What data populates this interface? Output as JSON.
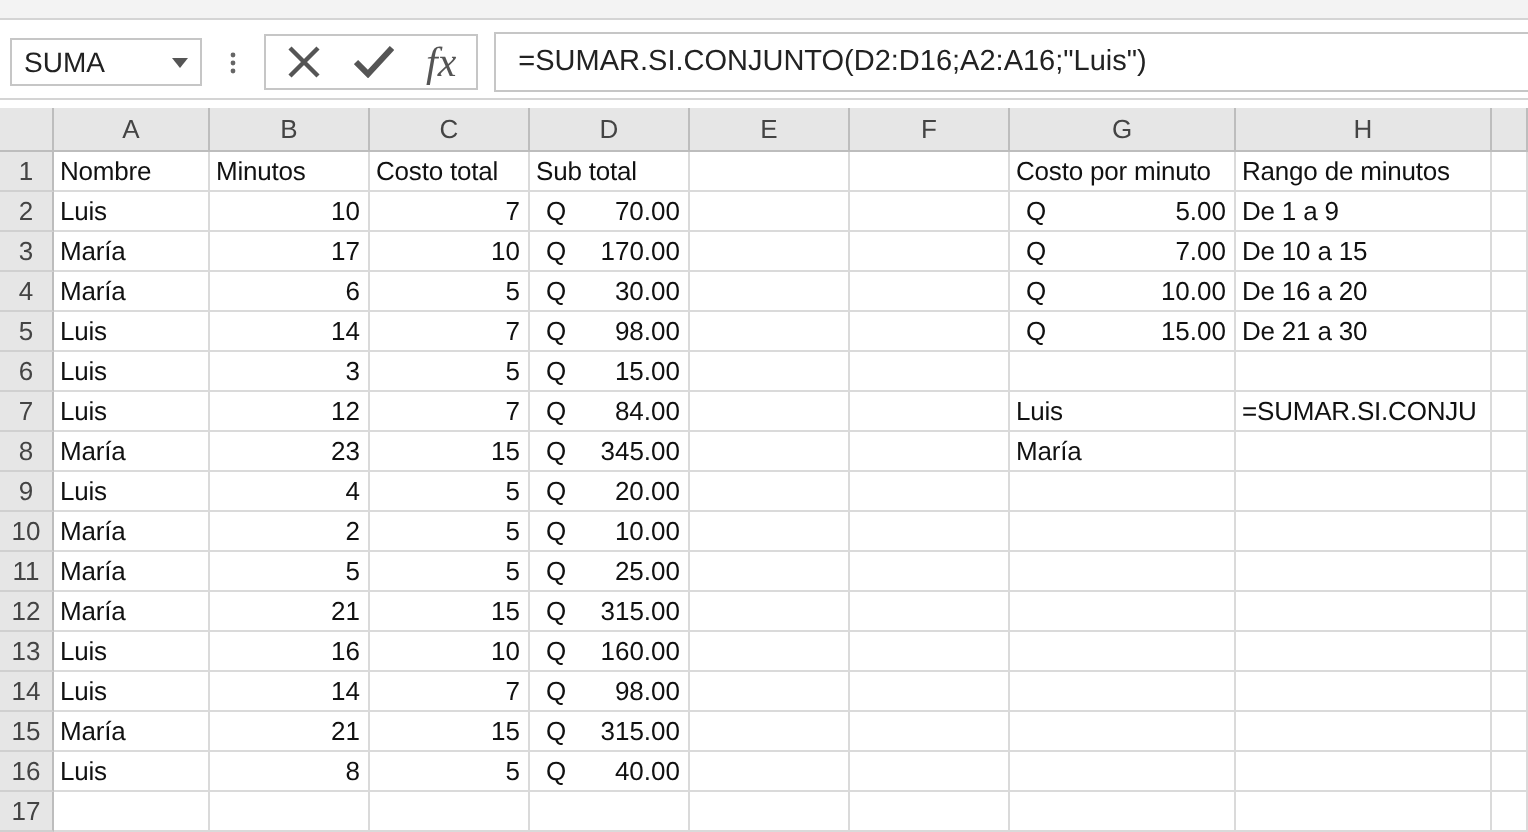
{
  "name_box": {
    "value": "SUMA"
  },
  "formula_bar": {
    "function_button": "fx",
    "formula": "=SUMAR.SI.CONJUNTO(D2:D16;A2:A16;\"Luis\")"
  },
  "columns": [
    "A",
    "B",
    "C",
    "D",
    "E",
    "F",
    "G",
    "H"
  ],
  "rows": [
    {
      "number": "1",
      "cells": [
        {
          "kind": "text",
          "text": "Nombre"
        },
        {
          "kind": "text",
          "text": "Minutos"
        },
        {
          "kind": "text",
          "text": "Costo total"
        },
        {
          "kind": "text",
          "text": "Sub total"
        },
        null,
        null,
        {
          "kind": "text",
          "text": "Costo por minuto"
        },
        {
          "kind": "text",
          "text": "Rango de minutos"
        }
      ]
    },
    {
      "number": "2",
      "cells": [
        {
          "kind": "text",
          "text": "Luis"
        },
        {
          "kind": "number",
          "text": "10"
        },
        {
          "kind": "number",
          "text": "7"
        },
        {
          "kind": "accounting",
          "symbol": "Q",
          "text": "70.00"
        },
        null,
        null,
        {
          "kind": "accounting",
          "symbol": "Q",
          "text": "5.00"
        },
        {
          "kind": "text",
          "text": "De 1 a 9"
        }
      ]
    },
    {
      "number": "3",
      "cells": [
        {
          "kind": "text",
          "text": "María"
        },
        {
          "kind": "number",
          "text": "17"
        },
        {
          "kind": "number",
          "text": "10"
        },
        {
          "kind": "accounting",
          "symbol": "Q",
          "text": "170.00"
        },
        null,
        null,
        {
          "kind": "accounting",
          "symbol": "Q",
          "text": "7.00"
        },
        {
          "kind": "text",
          "text": "De 10 a 15"
        }
      ]
    },
    {
      "number": "4",
      "cells": [
        {
          "kind": "text",
          "text": "María"
        },
        {
          "kind": "number",
          "text": "6"
        },
        {
          "kind": "number",
          "text": "5"
        },
        {
          "kind": "accounting",
          "symbol": "Q",
          "text": "30.00"
        },
        null,
        null,
        {
          "kind": "accounting",
          "symbol": "Q",
          "text": "10.00"
        },
        {
          "kind": "text",
          "text": "De 16 a 20"
        }
      ]
    },
    {
      "number": "5",
      "cells": [
        {
          "kind": "text",
          "text": "Luis"
        },
        {
          "kind": "number",
          "text": "14"
        },
        {
          "kind": "number",
          "text": "7"
        },
        {
          "kind": "accounting",
          "symbol": "Q",
          "text": "98.00"
        },
        null,
        null,
        {
          "kind": "accounting",
          "symbol": "Q",
          "text": "15.00"
        },
        {
          "kind": "text",
          "text": "De 21 a 30"
        }
      ]
    },
    {
      "number": "6",
      "cells": [
        {
          "kind": "text",
          "text": "Luis"
        },
        {
          "kind": "number",
          "text": "3"
        },
        {
          "kind": "number",
          "text": "5"
        },
        {
          "kind": "accounting",
          "symbol": "Q",
          "text": "15.00"
        },
        null,
        null,
        null,
        null
      ]
    },
    {
      "number": "7",
      "cells": [
        {
          "kind": "text",
          "text": "Luis"
        },
        {
          "kind": "number",
          "text": "12"
        },
        {
          "kind": "number",
          "text": "7"
        },
        {
          "kind": "accounting",
          "symbol": "Q",
          "text": "84.00"
        },
        null,
        null,
        {
          "kind": "text",
          "text": "Luis"
        },
        {
          "kind": "text",
          "text": "=SUMAR.SI.CONJU"
        }
      ]
    },
    {
      "number": "8",
      "cells": [
        {
          "kind": "text",
          "text": "María"
        },
        {
          "kind": "number",
          "text": "23"
        },
        {
          "kind": "number",
          "text": "15"
        },
        {
          "kind": "accounting",
          "symbol": "Q",
          "text": "345.00"
        },
        null,
        null,
        {
          "kind": "text",
          "text": "María"
        },
        null
      ]
    },
    {
      "number": "9",
      "cells": [
        {
          "kind": "text",
          "text": "Luis"
        },
        {
          "kind": "number",
          "text": "4"
        },
        {
          "kind": "number",
          "text": "5"
        },
        {
          "kind": "accounting",
          "symbol": "Q",
          "text": "20.00"
        },
        null,
        null,
        null,
        null
      ]
    },
    {
      "number": "10",
      "cells": [
        {
          "kind": "text",
          "text": "María"
        },
        {
          "kind": "number",
          "text": "2"
        },
        {
          "kind": "number",
          "text": "5"
        },
        {
          "kind": "accounting",
          "symbol": "Q",
          "text": "10.00"
        },
        null,
        null,
        null,
        null
      ]
    },
    {
      "number": "11",
      "cells": [
        {
          "kind": "text",
          "text": "María"
        },
        {
          "kind": "number",
          "text": "5"
        },
        {
          "kind": "number",
          "text": "5"
        },
        {
          "kind": "accounting",
          "symbol": "Q",
          "text": "25.00"
        },
        null,
        null,
        null,
        null
      ]
    },
    {
      "number": "12",
      "cells": [
        {
          "kind": "text",
          "text": "María"
        },
        {
          "kind": "number",
          "text": "21"
        },
        {
          "kind": "number",
          "text": "15"
        },
        {
          "kind": "accounting",
          "symbol": "Q",
          "text": "315.00"
        },
        null,
        null,
        null,
        null
      ]
    },
    {
      "number": "13",
      "cells": [
        {
          "kind": "text",
          "text": "Luis"
        },
        {
          "kind": "number",
          "text": "16"
        },
        {
          "kind": "number",
          "text": "10"
        },
        {
          "kind": "accounting",
          "symbol": "Q",
          "text": "160.00"
        },
        null,
        null,
        null,
        null
      ]
    },
    {
      "number": "14",
      "cells": [
        {
          "kind": "text",
          "text": "Luis"
        },
        {
          "kind": "number",
          "text": "14"
        },
        {
          "kind": "number",
          "text": "7"
        },
        {
          "kind": "accounting",
          "symbol": "Q",
          "text": "98.00"
        },
        null,
        null,
        null,
        null
      ]
    },
    {
      "number": "15",
      "cells": [
        {
          "kind": "text",
          "text": "María"
        },
        {
          "kind": "number",
          "text": "21"
        },
        {
          "kind": "number",
          "text": "15"
        },
        {
          "kind": "accounting",
          "symbol": "Q",
          "text": "315.00"
        },
        null,
        null,
        null,
        null
      ]
    },
    {
      "number": "16",
      "cells": [
        {
          "kind": "text",
          "text": "Luis"
        },
        {
          "kind": "number",
          "text": "8"
        },
        {
          "kind": "number",
          "text": "5"
        },
        {
          "kind": "accounting",
          "symbol": "Q",
          "text": "40.00"
        },
        null,
        null,
        null,
        null
      ]
    },
    {
      "number": "17",
      "cells": [
        null,
        null,
        null,
        null,
        null,
        null,
        null,
        null
      ]
    }
  ]
}
